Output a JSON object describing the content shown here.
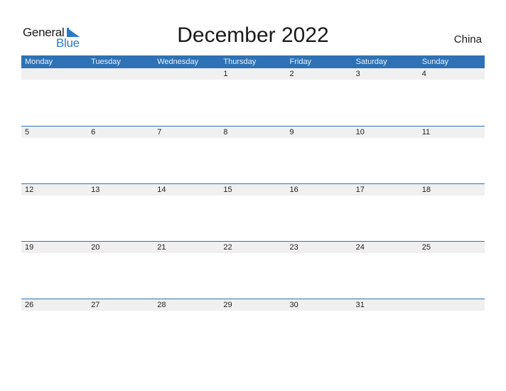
{
  "logo": {
    "line1": "General",
    "line2": "Blue"
  },
  "title": "December 2022",
  "country": "China",
  "days": [
    "Monday",
    "Tuesday",
    "Wednesday",
    "Thursday",
    "Friday",
    "Saturday",
    "Sunday"
  ],
  "weeks": [
    [
      "",
      "",
      "",
      "1",
      "2",
      "3",
      "4"
    ],
    [
      "5",
      "6",
      "7",
      "8",
      "9",
      "10",
      "11"
    ],
    [
      "12",
      "13",
      "14",
      "15",
      "16",
      "17",
      "18"
    ],
    [
      "19",
      "20",
      "21",
      "22",
      "23",
      "24",
      "25"
    ],
    [
      "26",
      "27",
      "28",
      "29",
      "30",
      "31",
      ""
    ]
  ],
  "colors": {
    "accent": "#2e72b5",
    "date_strip": "#f0f0f0"
  }
}
